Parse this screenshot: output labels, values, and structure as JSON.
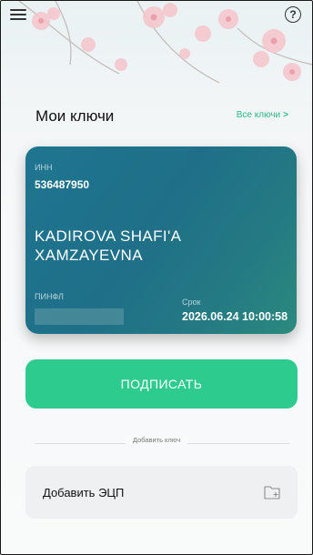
{
  "header": {
    "menu_icon": "hamburger-menu-icon",
    "help_icon": "question-circle-icon",
    "help_glyph": "?"
  },
  "keys_section": {
    "title": "Мои ключи",
    "all_keys_link": "Все ключи",
    "all_keys_chevron": ">"
  },
  "key_card": {
    "inn_label": "ИНН",
    "inn_value": "536487950",
    "owner_name": "KADIROVA SHAFI'A XAMZAYEVNA",
    "pinfl_label": "ПИНФЛ",
    "expiry_label": "Срок",
    "expiry_value": "2026.06.24 10:00:58"
  },
  "actions": {
    "sign_button": "ПОДПИСАТЬ",
    "add_key_divider": "Добавить ключ",
    "add_ecp_label": "Добавить ЭЦП",
    "add_ecp_icon": "folder-add-icon"
  },
  "colors": {
    "accent_green": "#2ecb8f",
    "link_green": "#2fb783",
    "card_teal": "#1f7590"
  }
}
